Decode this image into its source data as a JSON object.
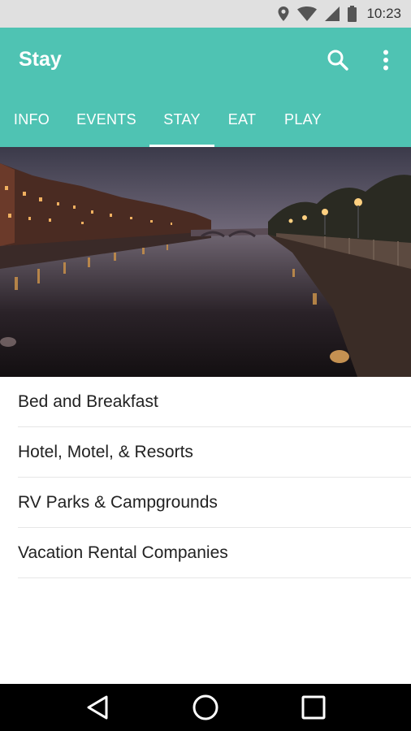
{
  "status_bar": {
    "time": "10:23",
    "icons": [
      "location-icon",
      "wifi-icon",
      "signal-icon",
      "battery-icon"
    ]
  },
  "app_bar": {
    "title": "Stay",
    "color": "#4fc3b3",
    "actions": [
      "search-icon",
      "more-vert-icon"
    ]
  },
  "tabs": [
    {
      "label": "INFO"
    },
    {
      "label": "EVENTS"
    },
    {
      "label": "STAY",
      "active": true
    },
    {
      "label": "EAT"
    },
    {
      "label": "PLAY"
    }
  ],
  "hero": {
    "icon": "waterfront-photo"
  },
  "list": {
    "items": [
      {
        "label": "Bed and Breakfast"
      },
      {
        "label": "Hotel, Motel, & Resorts"
      },
      {
        "label": "RV Parks & Campgrounds"
      },
      {
        "label": "Vacation Rental Companies"
      }
    ]
  },
  "nav_bar": {
    "buttons": [
      "back-icon",
      "home-icon",
      "recents-icon"
    ]
  }
}
